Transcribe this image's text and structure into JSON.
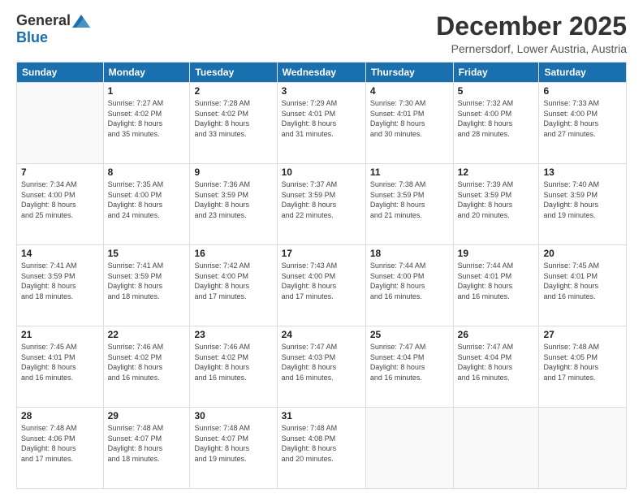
{
  "logo": {
    "general": "General",
    "blue": "Blue"
  },
  "title": "December 2025",
  "location": "Pernersdorf, Lower Austria, Austria",
  "days_of_week": [
    "Sunday",
    "Monday",
    "Tuesday",
    "Wednesday",
    "Thursday",
    "Friday",
    "Saturday"
  ],
  "weeks": [
    [
      {
        "day": "",
        "info": ""
      },
      {
        "day": "1",
        "info": "Sunrise: 7:27 AM\nSunset: 4:02 PM\nDaylight: 8 hours\nand 35 minutes."
      },
      {
        "day": "2",
        "info": "Sunrise: 7:28 AM\nSunset: 4:02 PM\nDaylight: 8 hours\nand 33 minutes."
      },
      {
        "day": "3",
        "info": "Sunrise: 7:29 AM\nSunset: 4:01 PM\nDaylight: 8 hours\nand 31 minutes."
      },
      {
        "day": "4",
        "info": "Sunrise: 7:30 AM\nSunset: 4:01 PM\nDaylight: 8 hours\nand 30 minutes."
      },
      {
        "day": "5",
        "info": "Sunrise: 7:32 AM\nSunset: 4:00 PM\nDaylight: 8 hours\nand 28 minutes."
      },
      {
        "day": "6",
        "info": "Sunrise: 7:33 AM\nSunset: 4:00 PM\nDaylight: 8 hours\nand 27 minutes."
      }
    ],
    [
      {
        "day": "7",
        "info": "Sunrise: 7:34 AM\nSunset: 4:00 PM\nDaylight: 8 hours\nand 25 minutes."
      },
      {
        "day": "8",
        "info": "Sunrise: 7:35 AM\nSunset: 4:00 PM\nDaylight: 8 hours\nand 24 minutes."
      },
      {
        "day": "9",
        "info": "Sunrise: 7:36 AM\nSunset: 3:59 PM\nDaylight: 8 hours\nand 23 minutes."
      },
      {
        "day": "10",
        "info": "Sunrise: 7:37 AM\nSunset: 3:59 PM\nDaylight: 8 hours\nand 22 minutes."
      },
      {
        "day": "11",
        "info": "Sunrise: 7:38 AM\nSunset: 3:59 PM\nDaylight: 8 hours\nand 21 minutes."
      },
      {
        "day": "12",
        "info": "Sunrise: 7:39 AM\nSunset: 3:59 PM\nDaylight: 8 hours\nand 20 minutes."
      },
      {
        "day": "13",
        "info": "Sunrise: 7:40 AM\nSunset: 3:59 PM\nDaylight: 8 hours\nand 19 minutes."
      }
    ],
    [
      {
        "day": "14",
        "info": "Sunrise: 7:41 AM\nSunset: 3:59 PM\nDaylight: 8 hours\nand 18 minutes."
      },
      {
        "day": "15",
        "info": "Sunrise: 7:41 AM\nSunset: 3:59 PM\nDaylight: 8 hours\nand 18 minutes."
      },
      {
        "day": "16",
        "info": "Sunrise: 7:42 AM\nSunset: 4:00 PM\nDaylight: 8 hours\nand 17 minutes."
      },
      {
        "day": "17",
        "info": "Sunrise: 7:43 AM\nSunset: 4:00 PM\nDaylight: 8 hours\nand 17 minutes."
      },
      {
        "day": "18",
        "info": "Sunrise: 7:44 AM\nSunset: 4:00 PM\nDaylight: 8 hours\nand 16 minutes."
      },
      {
        "day": "19",
        "info": "Sunrise: 7:44 AM\nSunset: 4:01 PM\nDaylight: 8 hours\nand 16 minutes."
      },
      {
        "day": "20",
        "info": "Sunrise: 7:45 AM\nSunset: 4:01 PM\nDaylight: 8 hours\nand 16 minutes."
      }
    ],
    [
      {
        "day": "21",
        "info": "Sunrise: 7:45 AM\nSunset: 4:01 PM\nDaylight: 8 hours\nand 16 minutes."
      },
      {
        "day": "22",
        "info": "Sunrise: 7:46 AM\nSunset: 4:02 PM\nDaylight: 8 hours\nand 16 minutes."
      },
      {
        "day": "23",
        "info": "Sunrise: 7:46 AM\nSunset: 4:02 PM\nDaylight: 8 hours\nand 16 minutes."
      },
      {
        "day": "24",
        "info": "Sunrise: 7:47 AM\nSunset: 4:03 PM\nDaylight: 8 hours\nand 16 minutes."
      },
      {
        "day": "25",
        "info": "Sunrise: 7:47 AM\nSunset: 4:04 PM\nDaylight: 8 hours\nand 16 minutes."
      },
      {
        "day": "26",
        "info": "Sunrise: 7:47 AM\nSunset: 4:04 PM\nDaylight: 8 hours\nand 16 minutes."
      },
      {
        "day": "27",
        "info": "Sunrise: 7:48 AM\nSunset: 4:05 PM\nDaylight: 8 hours\nand 17 minutes."
      }
    ],
    [
      {
        "day": "28",
        "info": "Sunrise: 7:48 AM\nSunset: 4:06 PM\nDaylight: 8 hours\nand 17 minutes."
      },
      {
        "day": "29",
        "info": "Sunrise: 7:48 AM\nSunset: 4:07 PM\nDaylight: 8 hours\nand 18 minutes."
      },
      {
        "day": "30",
        "info": "Sunrise: 7:48 AM\nSunset: 4:07 PM\nDaylight: 8 hours\nand 19 minutes."
      },
      {
        "day": "31",
        "info": "Sunrise: 7:48 AM\nSunset: 4:08 PM\nDaylight: 8 hours\nand 20 minutes."
      },
      {
        "day": "",
        "info": ""
      },
      {
        "day": "",
        "info": ""
      },
      {
        "day": "",
        "info": ""
      }
    ]
  ]
}
